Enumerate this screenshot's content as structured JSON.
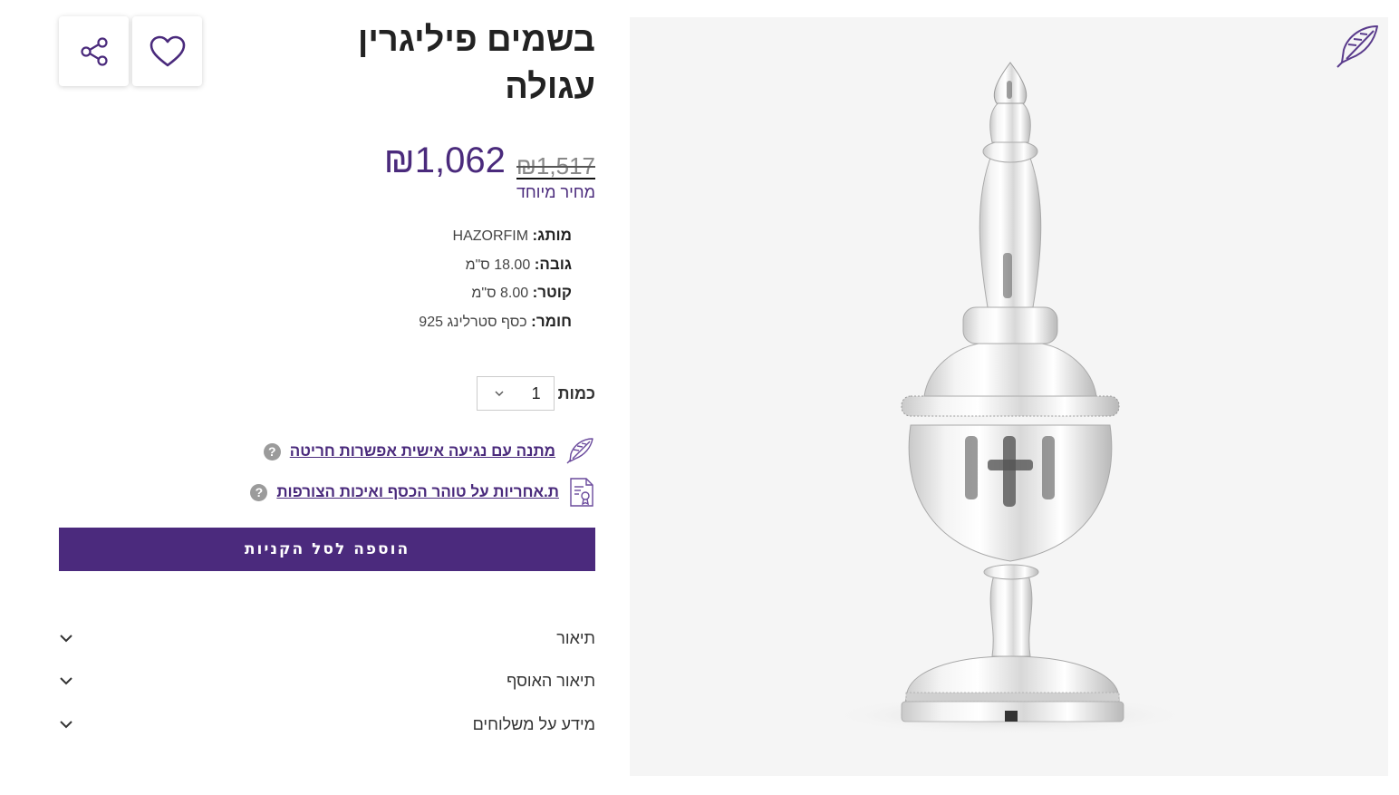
{
  "product": {
    "title_line1": "בשמים פיליגרין",
    "title_line2": "עגולה",
    "price_new": "₪1,062",
    "price_old": "₪1,517",
    "special_label": "מחיר מיוחד"
  },
  "specs": [
    {
      "key": "מותג:",
      "value": "HAZORFIM"
    },
    {
      "key": "גובה:",
      "value": "18.00 ס\"מ"
    },
    {
      "key": "קוטר:",
      "value": "8.00 ס\"מ"
    },
    {
      "key": "חומר:",
      "value": "כסף סטרלינג 925"
    }
  ],
  "quantity": {
    "label": "כמות",
    "value": "1"
  },
  "features": [
    {
      "label": "מתנה עם נגיעה אישית  אפשרות חריטה",
      "icon": "feather-pen-icon",
      "help": "?"
    },
    {
      "label": "ת.אחריות על טוהר הכסף ואיכות הצורפות",
      "icon": "certificate-icon",
      "help": "?"
    }
  ],
  "cart_button": "הוספה לסל הקניות",
  "accordion": [
    "תיאור",
    "תיאור האוסף",
    "מידע על משלוחים"
  ],
  "icons": {
    "share": "share-icon",
    "wishlist": "heart-icon",
    "badge": "feather-pen-icon",
    "chevron": "chevron-down-icon"
  },
  "colors": {
    "brand_purple": "#4b2a7d",
    "price": "#4a2a7c",
    "image_bg": "#f5f5f5"
  }
}
